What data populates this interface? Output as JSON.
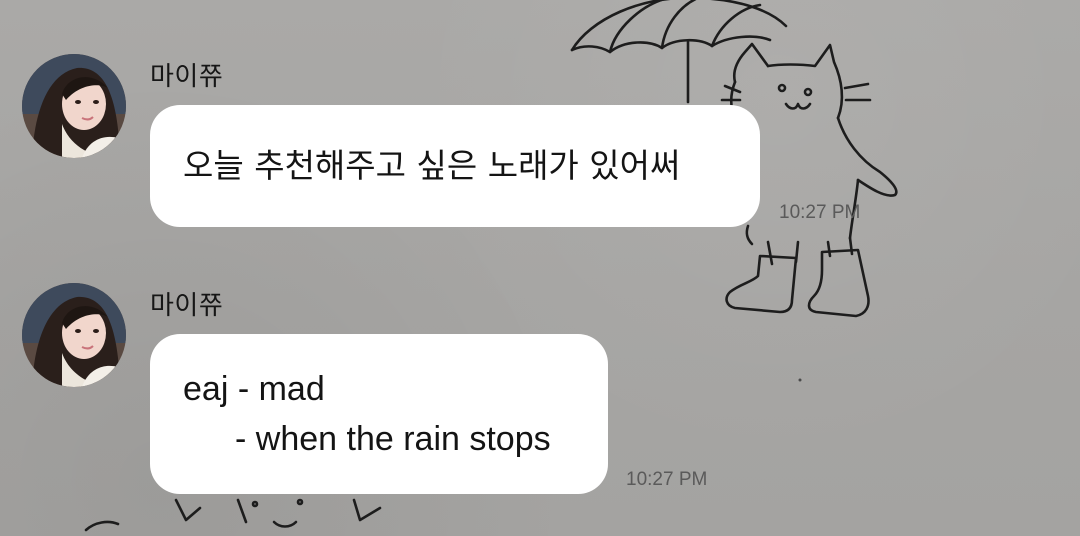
{
  "chat": {
    "messages": [
      {
        "sender": "마이쮸",
        "avatar": "profile-photo",
        "text": "오늘 추천해주고 싶은 노래가 있어써",
        "time": "10:27 PM"
      },
      {
        "sender": "마이쮸",
        "avatar": "profile-photo",
        "lines": [
          "eaj - mad",
          "- when the rain stops"
        ],
        "time": "10:27 PM"
      }
    ]
  },
  "colors": {
    "background": "#a7a7a5",
    "bubble": "#ffffff",
    "text": "#141414",
    "timestamp": "#5a5a5a"
  }
}
